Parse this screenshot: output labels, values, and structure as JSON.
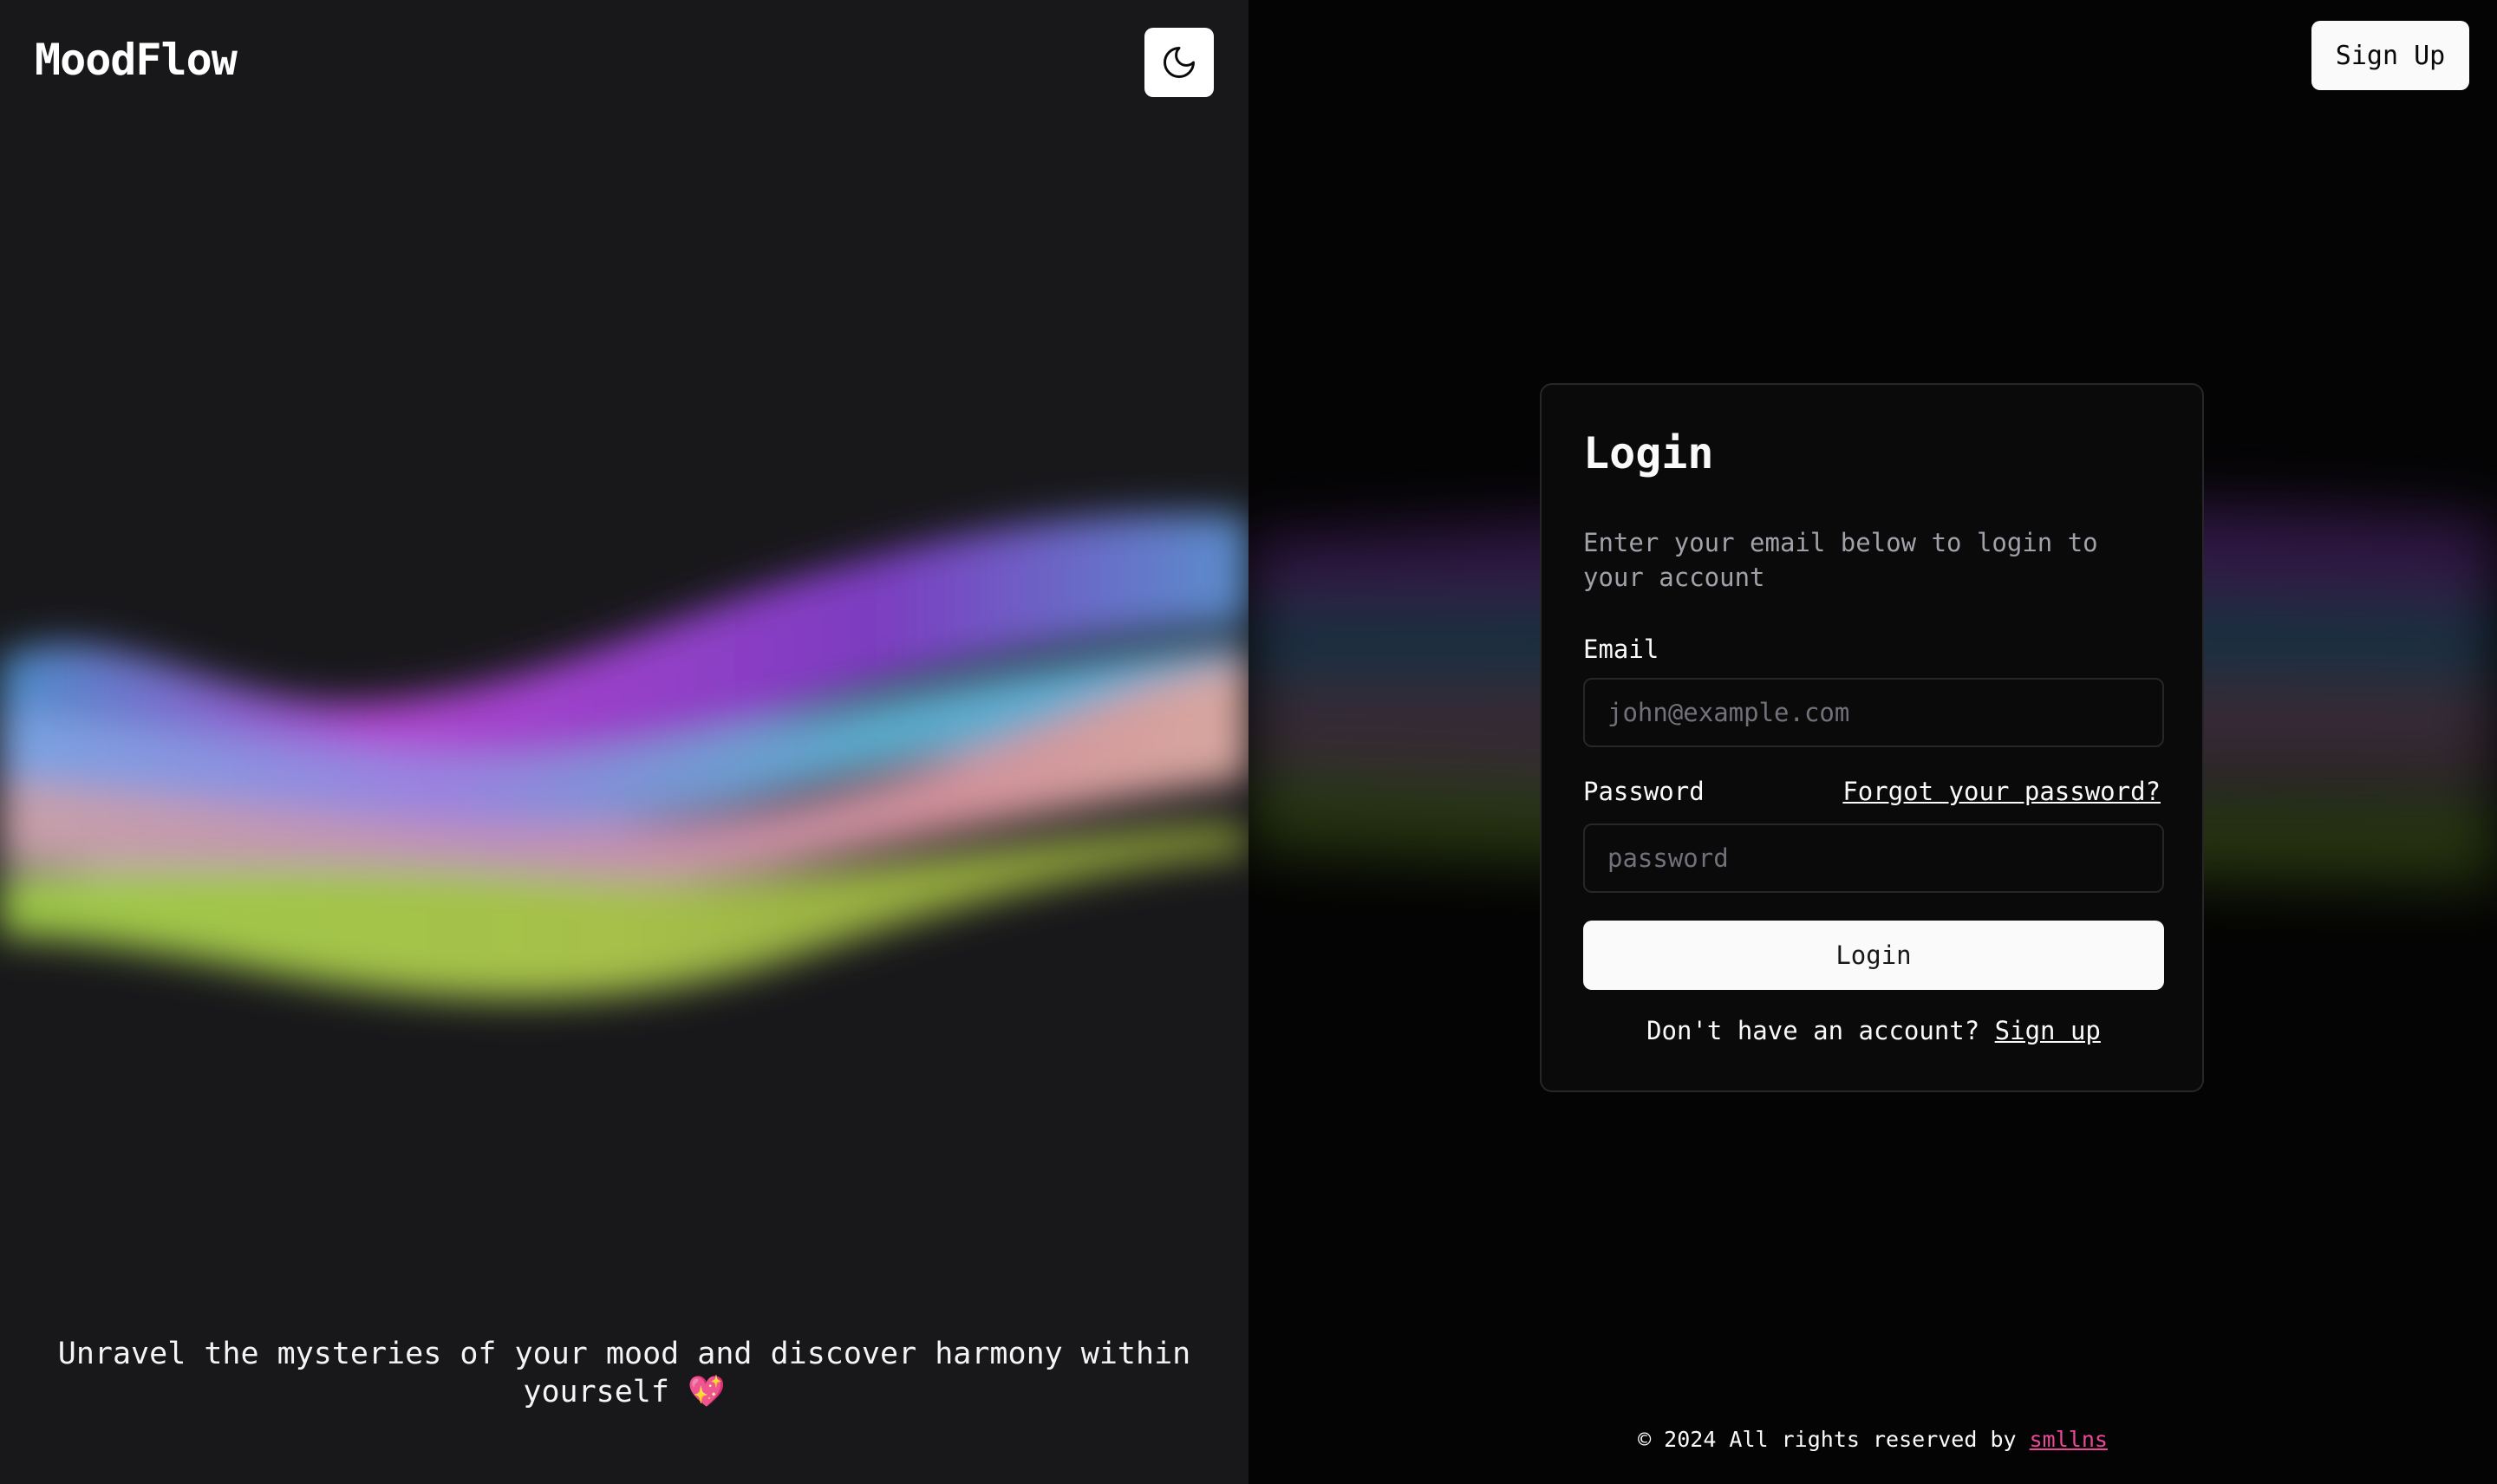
{
  "brand": {
    "name": "MoodFlow"
  },
  "header": {
    "theme_toggle_icon": "moon-icon",
    "signup_label": "Sign Up"
  },
  "hero": {
    "tagline": "Unravel the mysteries of your mood and discover harmony within yourself 💖"
  },
  "login_form": {
    "title": "Login",
    "description": "Enter your email below to login to your account",
    "email_label": "Email",
    "email_placeholder": "john@example.com",
    "password_label": "Password",
    "forgot_label": "Forgot your password?",
    "password_placeholder": "password",
    "submit_label": "Login",
    "no_account_text": "Don't have an account?",
    "signup_link": "Sign up"
  },
  "footer": {
    "text": "© 2024 All rights reserved by",
    "author": "smllns"
  },
  "colors": {
    "author_link": "#ec4899",
    "panel_bg": "#18181b",
    "page_bg": "#040404"
  }
}
